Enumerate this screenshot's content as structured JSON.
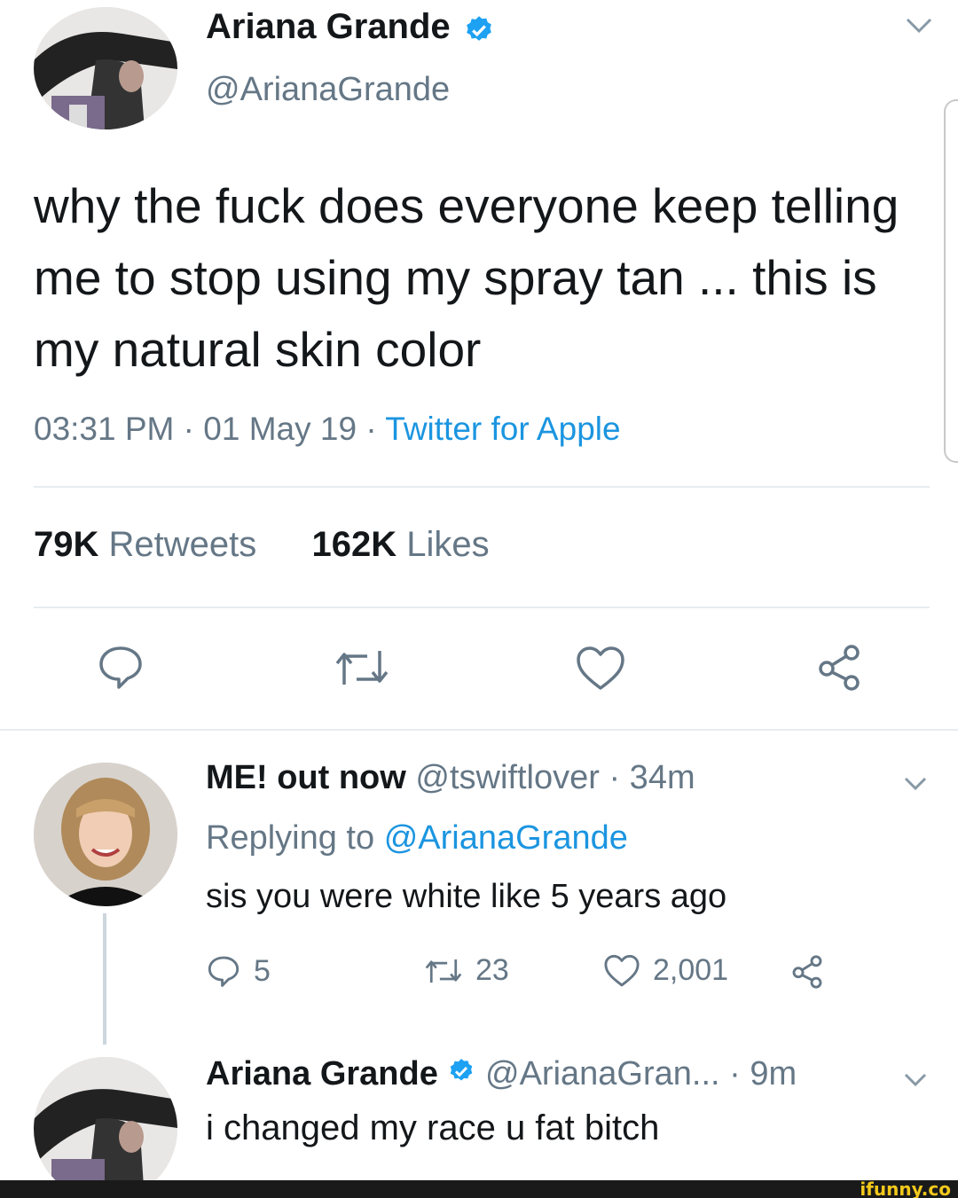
{
  "tweet": {
    "author_name": "Ariana Grande",
    "author_handle": "@ArianaGrande",
    "text": "why the fuck does everyone keep telling me to stop using my spray tan ... this is my natural skin color",
    "time": "03:31 PM",
    "date": "01 May 19",
    "source": "Twitter for Apple",
    "separator": "·",
    "retweets_count": "79K",
    "retweets_label": "Retweets",
    "likes_count": "162K",
    "likes_label": "Likes"
  },
  "reply1": {
    "author_name": "ME! out now",
    "author_handle": "@tswiftlover",
    "time": "· 34m",
    "replying_prefix": "Replying to",
    "replying_to": "@ArianaGrande",
    "text": "sis you were white like 5 years ago",
    "reply_count": "5",
    "retweet_count": "23",
    "like_count": "2,001"
  },
  "reply2": {
    "author_name": "Ariana Grande",
    "author_handle": "@ArianaGran...",
    "time": "· 9m",
    "text": "i changed my race u fat bitch"
  },
  "footer": {
    "logo": "ifunny.co"
  },
  "colors": {
    "accent": "#1b95e0",
    "muted": "#657786",
    "text": "#14171a"
  }
}
